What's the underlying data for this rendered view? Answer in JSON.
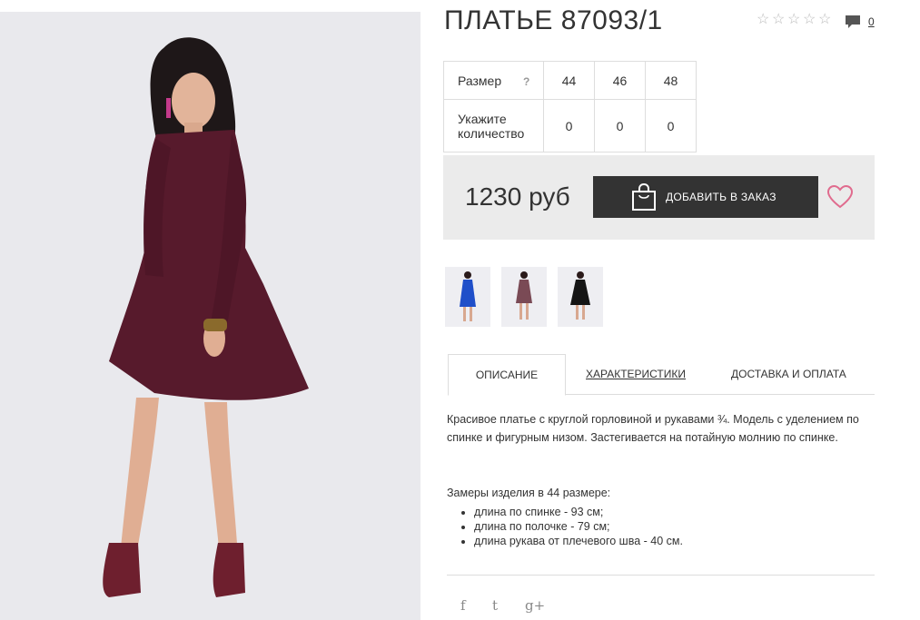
{
  "product": {
    "title": "ПЛАТЬЕ 87093/1",
    "rating": 0,
    "rating_max": 5,
    "comment_count": "0"
  },
  "sizes": {
    "size_label": "Размер",
    "help": "?",
    "values": [
      "44",
      "46",
      "48"
    ],
    "qty_label": "Укажите количество",
    "quantities": [
      "0",
      "0",
      "0"
    ]
  },
  "buy": {
    "price": "1230 руб",
    "add_button": "ДОБАВИТЬ В ЗАКАЗ"
  },
  "thumbnails": [
    {
      "name": "blue-dress",
      "color": "#1f4fc9"
    },
    {
      "name": "burgundy-dress",
      "color": "#5a1a2a"
    },
    {
      "name": "black-dress",
      "color": "#151515"
    }
  ],
  "tabs": [
    "ОПИСАНИЕ",
    "ХАРАКТЕРИСТИКИ",
    "ДОСТАВКА И ОПЛАТА"
  ],
  "description": "Красивое платье с круглой горловиной и рукавами ¾. Модель с уделением по спинке и фигурным низом. Застегивается на потайную молнию по спинке.",
  "measures": {
    "title": "Замеры изделия в 44 размере:",
    "items": [
      "длина по спинке - 93 см;",
      "длина по полочке - 79 см;",
      "длина рукава от плечевого шва - 40 см."
    ]
  },
  "social": [
    "f",
    "t",
    "g+"
  ],
  "colors": {
    "dress": "#571a2c",
    "button": "#333333",
    "heart": "#e06b8e",
    "buybox": "#ebebeb"
  }
}
